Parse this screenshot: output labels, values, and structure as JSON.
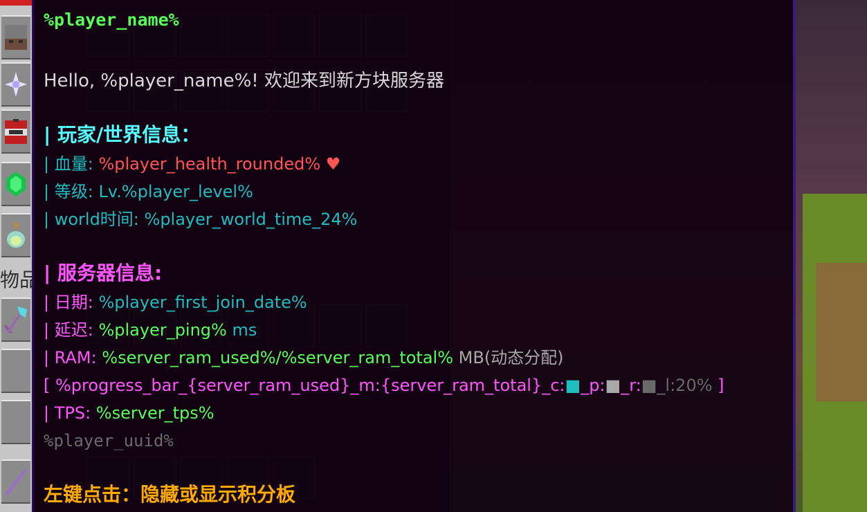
{
  "hotbar": {
    "label": "物品",
    "icons": [
      "furnace-block-icon",
      "nether-star-icon",
      "tnt-icon",
      "emerald-icon",
      "experience-bottle-icon",
      "diamond-axe-icon",
      "empty-slot",
      "empty-slot",
      "amethyst-rod-icon"
    ]
  },
  "tooltip": {
    "title": "%player_name%",
    "greeting": "Hello, %player_name%! 欢迎来到新方块服务器",
    "section_player": "| 玩家/世界信息：",
    "health_label": "| 血量: ",
    "health_value": "%player_health_rounded%",
    "heart": "♥",
    "level_label": "| 等级: ",
    "level_value": "Lv.%player_level%",
    "world_label": "| world时间: ",
    "world_value": "%player_world_time_24%",
    "section_server": "| 服务器信息:",
    "date_label": "| 日期: ",
    "date_value": "%player_first_join_date%",
    "ping_label": "| 延迟: ",
    "ping_value": "%player_ping%",
    "ping_unit": " ms",
    "ram_label": "| RAM: ",
    "ram_value": "%server_ram_used%/%server_ram_total%",
    "ram_unit": " MB(动态分配)",
    "progress_open": "[ ",
    "progress_value": "%progress_bar_{server_ram_used}_m:{server_ram_total}_c:",
    "progress_c_glyph": "■",
    "progress_p": "_p:",
    "progress_p_glyph": "■",
    "progress_r": "_r:",
    "progress_r_glyph": "■",
    "progress_tail": "_l:20%",
    "progress_close": " ]",
    "tps_label": "| TPS: ",
    "tps_value": "%server_tps%",
    "uuid": "%player_uuid%",
    "footer": "左键点击：隐藏或显示积分板"
  },
  "colors": {
    "title": "#55ff55",
    "aqua": "#1fbdbd",
    "pink": "#ff55ff",
    "red": "#ff5555",
    "gold": "#ffaa00",
    "gray": "#a8a8a8"
  }
}
